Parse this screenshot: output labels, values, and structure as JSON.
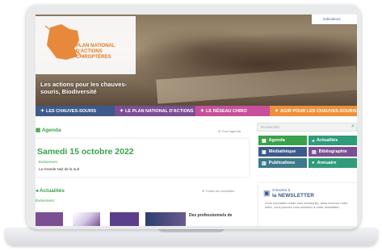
{
  "header": {
    "logo_text": "Plan National d'Actions Chiroptères",
    "tagline": "Les actions pour les chauves-souris, Biodiversité",
    "corner_badge": "indicateurs"
  },
  "nav": {
    "items": [
      {
        "label": "LES CHAUVES-SOURIS",
        "icon": "bat-icon",
        "color": "#3d5a8a"
      },
      {
        "label": "LE PLAN NATIONAL D'ACTIONS",
        "icon": "bat-icon",
        "color": "#7a4f93"
      },
      {
        "label": "LE RÉSEAU CHIRO",
        "icon": "bat-icon",
        "color": "#c6519a"
      },
      {
        "label": "AGIR POUR LES CHAUVES-SOURIS",
        "icon": "bat-icon",
        "color": "#ef8f3b"
      }
    ]
  },
  "agenda": {
    "title": "Agenda",
    "link": "Tout l'agenda",
    "date": "Samedi 15 octobre 2022",
    "category": "Événement",
    "event": "La Grande Nuit de la nuit"
  },
  "actualites": {
    "title": "Actualités",
    "link": "Toutes les actualités",
    "category": "Événement",
    "news_item": "Des professionnels de"
  },
  "sidebar": {
    "search_placeholder": "Rechercher",
    "buttons": [
      {
        "label": "Agenda",
        "icon": "calendar-icon",
        "color": "#3aa14a"
      },
      {
        "label": "Actualités",
        "icon": "megaphone-icon",
        "color": "#2f9b7a"
      },
      {
        "label": "Médiathèque",
        "icon": "image-icon",
        "color": "#3d5a8a"
      },
      {
        "label": "Bibliographie",
        "icon": "book-icon",
        "color": "#7a4f93"
      },
      {
        "label": "Publications",
        "icon": "document-icon",
        "color": "#3d7a8a"
      },
      {
        "label": "Annuaire",
        "icon": "person-icon",
        "color": "#2f9b7a"
      }
    ],
    "newsletter": {
      "pre": "S'inscrire à",
      "title": "la NEWSLETTER",
      "description": "Vous souhaitez rester bien informé(e), ainsi recevoir notre lettre, vous pouvez vous abonner à notre newsletter."
    }
  },
  "colors": {
    "green": "#3aa14a",
    "blue": "#3d5a8a",
    "purple": "#7a4f93",
    "pink": "#c6519a",
    "orange": "#ef8f3b"
  }
}
